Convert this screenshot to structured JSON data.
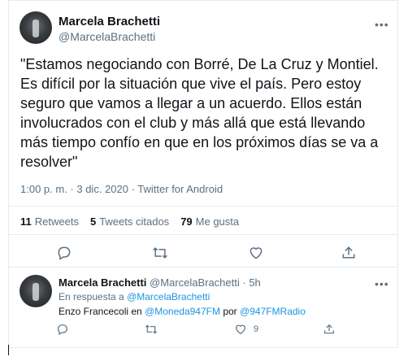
{
  "main_tweet": {
    "author_name": "Marcela Brachetti",
    "author_handle": "@MarcelaBrachetti",
    "more_label": "•••",
    "text": "\"Estamos negociando con Borré, De La Cruz y Montiel. Es difícil por la situación que vive el país. Pero estoy seguro que vamos a llegar a un acuerdo. Ellos están involucrados con el club y más allá que está llevando más tiempo confío en que en los próximos días se va a resolver\"",
    "timestamp": "1:00 p. m. · 3 dic. 2020",
    "separator": " · ",
    "source": "Twitter for Android",
    "stats": {
      "retweets_count": "11",
      "retweets_label": "Retweets",
      "quotes_count": "5",
      "quotes_label": "Tweets citados",
      "likes_count": "79",
      "likes_label": "Me gusta"
    }
  },
  "reply_tweet": {
    "author_name": "Marcela Brachetti",
    "author_handle": "@MarcelaBrachetti",
    "time": "· 5h",
    "more_label": "•••",
    "reply_prefix": "En respuesta a",
    "reply_to": "@MarcelaBrachetti",
    "text_prefix": "Enzo Francecoli en",
    "mention_1": "@Moneda947FM",
    "text_mid": "por",
    "mention_2": "@947FMRadio",
    "like_count": "9"
  },
  "icons": [
    "reply-icon",
    "retweet-icon",
    "like-icon",
    "share-icon"
  ],
  "colors": {
    "link": "#1b95e0",
    "muted": "#5b7083",
    "text": "#0f1419",
    "border": "#e6ecf0"
  }
}
